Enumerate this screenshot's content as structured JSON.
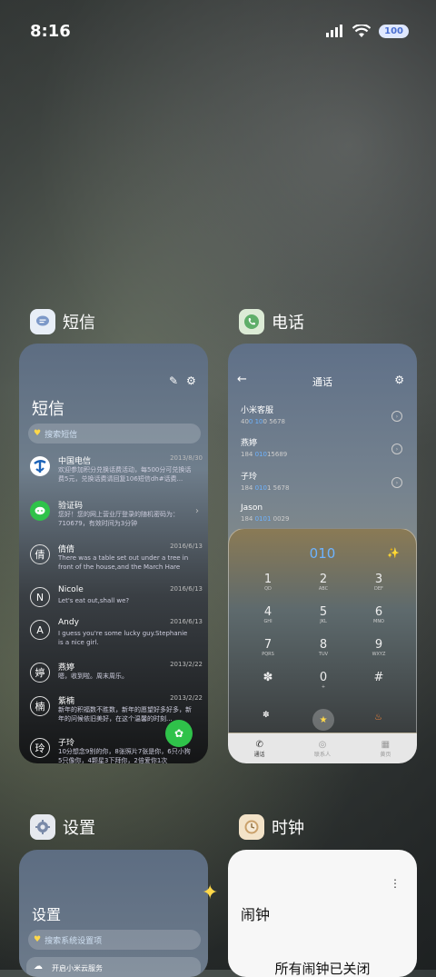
{
  "status": {
    "time": "8:16",
    "battery": "100"
  },
  "apps": {
    "messages": {
      "label": "短信",
      "title": "短信",
      "search_placeholder": "搜索短信",
      "conversations": [
        {
          "avatar": "",
          "name": "中国电信",
          "date": "2013/8/30",
          "preview": "欢迎参加积分兑换话费活动，每500分可兑换话费5元，兑换话费请回复106短信dh#话费..."
        },
        {
          "avatar": "",
          "name": "验证码",
          "date": "",
          "preview": "您好！您的网上营业厅登录的随机密码为：710679，有效时间为3分钟"
        },
        {
          "avatar": "倩",
          "name": "倩倩",
          "date": "2016/6/13",
          "preview": "There was a table set out under a tree in front of the house,and the March Hare an..."
        },
        {
          "avatar": "N",
          "name": "Nicole",
          "date": "2016/6/13",
          "preview": "Let's eat out,shall we?"
        },
        {
          "avatar": "A",
          "name": "Andy",
          "date": "2016/6/13",
          "preview": "I guess you're some lucky guy.Stephanie is a nice girl."
        },
        {
          "avatar": "婷",
          "name": "燕婷",
          "date": "2013/2/22",
          "preview": "嗯，收到啦。周末周乐。"
        },
        {
          "avatar": "楠",
          "name": "紫楠",
          "date": "2013/2/22",
          "preview": "新年的积福数不胜数，新年的愿望好多好多，新年的问候依旧美好，在这个温馨的时刻..."
        },
        {
          "avatar": "玲",
          "name": "子玲",
          "date": "",
          "preview": "10分想念9别的你，8张照片7张是你，6只小狗5只像你，4颗星3下拜你，2倍爱你1次"
        }
      ]
    },
    "phone": {
      "label": "电话",
      "title": "通话",
      "contacts": [
        {
          "name": "小米客服",
          "num_pre": "40",
          "num_hl": "0 10",
          "num_post": "0 5678"
        },
        {
          "name": "燕婷",
          "num_pre": "184 ",
          "num_hl": "010",
          "num_post": "15689"
        },
        {
          "name": "子玲",
          "num_pre": "184 ",
          "num_hl": "010",
          "num_post": "1 5678"
        },
        {
          "name": "Jason",
          "num_pre": "184 ",
          "num_hl": "0101",
          "num_post": " 0029"
        }
      ],
      "dialed": "010",
      "keys": [
        {
          "d": "1",
          "l": "QD"
        },
        {
          "d": "2",
          "l": "ABC"
        },
        {
          "d": "3",
          "l": "DEF"
        },
        {
          "d": "4",
          "l": "GHI"
        },
        {
          "d": "5",
          "l": "JKL"
        },
        {
          "d": "6",
          "l": "MNO"
        },
        {
          "d": "7",
          "l": "PQRS"
        },
        {
          "d": "8",
          "l": "TUV"
        },
        {
          "d": "9",
          "l": "WXYZ"
        },
        {
          "d": "✽",
          "l": ""
        },
        {
          "d": "0",
          "l": "+"
        },
        {
          "d": "#",
          "l": ""
        }
      ],
      "tabs": [
        "通话",
        "联系人",
        "黄页"
      ]
    },
    "settings": {
      "label": "设置",
      "title": "设置",
      "search_placeholder": "搜索系统设置项",
      "first_row": "开启小米云服务"
    },
    "clock": {
      "label": "时钟",
      "title": "闹钟",
      "message": "所有闹钟已关闭"
    }
  },
  "colors": {
    "dial_highlight": "#6db3ff",
    "fab_green": "#2fc24a",
    "sparkle": "#ffd84a"
  }
}
